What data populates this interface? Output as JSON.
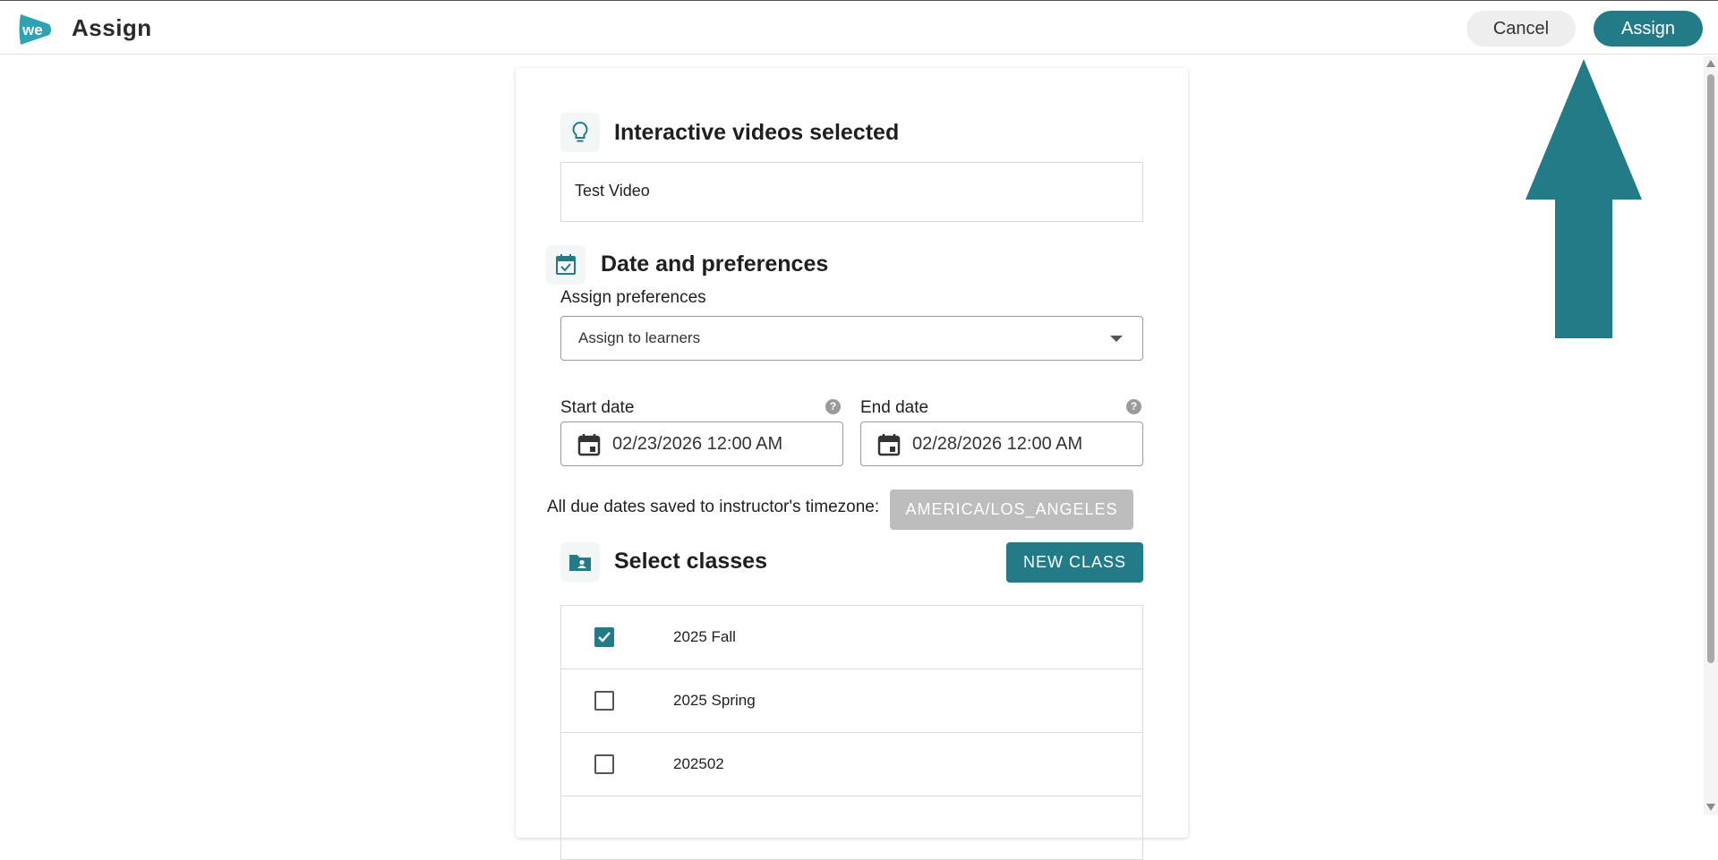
{
  "header": {
    "title": "Assign",
    "cancel_label": "Cancel",
    "assign_label": "Assign"
  },
  "videos_section": {
    "title": "Interactive videos selected",
    "video_name": "Test Video"
  },
  "dates_section": {
    "title": "Date and preferences",
    "assign_prefs_label": "Assign preferences",
    "assign_prefs_value": "Assign to learners",
    "start_label": "Start date",
    "start_value": "02/23/2026 12:00 AM",
    "end_label": "End date",
    "end_value": "02/28/2026 12:00 AM",
    "help_glyph": "?",
    "timezone_text": "All due dates saved to instructor's timezone:",
    "timezone_value": "AMERICA/LOS_ANGELES"
  },
  "classes_section": {
    "title": "Select classes",
    "new_class_label": "NEW CLASS",
    "items": [
      {
        "name": "2025 Fall",
        "checked": true
      },
      {
        "name": "2025 Spring",
        "checked": false
      },
      {
        "name": "202502",
        "checked": false
      },
      {
        "name": "",
        "checked": false
      }
    ]
  },
  "colors": {
    "brand": "#227b87",
    "badge_gray": "#bdbdbd"
  },
  "icons": {
    "logo": "we-logo",
    "videos": "lightbulb-icon",
    "dates": "calendar-check-icon",
    "classes": "folder-user-icon",
    "date_field": "calendar-icon"
  }
}
